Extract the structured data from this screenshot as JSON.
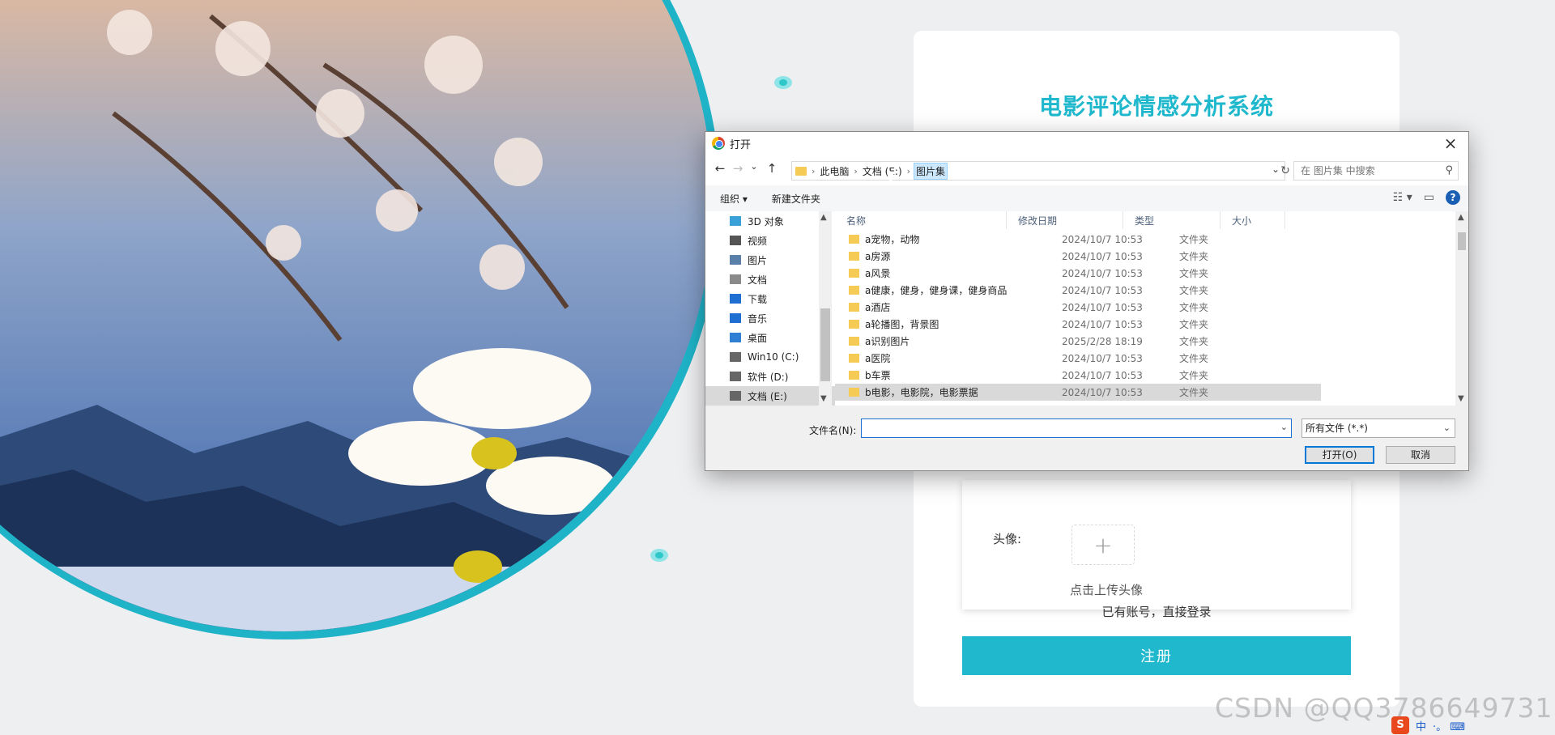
{
  "background": {
    "title": "电影评论情感分析系统",
    "avatar_label": "头像:",
    "avatar_plus": "+",
    "avatar_hint": "点击上传头像",
    "login_link": "已有账号，直接登录",
    "register_button": "注册",
    "accent_color": "#1fb8cd",
    "watermark": "CSDN @QQ3786649731"
  },
  "dialog": {
    "title": "打开",
    "close_icon": "×",
    "nav": {
      "back": "←",
      "forward": "→",
      "recent": "⌄",
      "up": "↑",
      "refresh": "↻"
    },
    "breadcrumbs": [
      "此电脑",
      "文档 (E:)",
      "图片集"
    ],
    "search_placeholder": "在 图片集 中搜索",
    "toolbar": {
      "organize": "组织 ▾",
      "new_folder": "新建文件夹",
      "help": "?"
    },
    "nav_items": [
      {
        "label": "3D 对象",
        "icon": "3d-objects-icon"
      },
      {
        "label": "视频",
        "icon": "video-icon"
      },
      {
        "label": "图片",
        "icon": "pictures-icon"
      },
      {
        "label": "文档",
        "icon": "documents-icon"
      },
      {
        "label": "下载",
        "icon": "download-icon"
      },
      {
        "label": "音乐",
        "icon": "music-icon"
      },
      {
        "label": "桌面",
        "icon": "desktop-icon"
      },
      {
        "label": "Win10 (C:)",
        "icon": "drive-icon"
      },
      {
        "label": "软件 (D:)",
        "icon": "drive-icon"
      },
      {
        "label": "文档 (E:)",
        "icon": "drive-icon",
        "selected": true
      }
    ],
    "columns": [
      "名称",
      "修改日期",
      "类型",
      "大小"
    ],
    "files": [
      {
        "name": "a宠物，动物",
        "date": "2024/10/7 10:53",
        "type": "文件夹"
      },
      {
        "name": "a房源",
        "date": "2024/10/7 10:53",
        "type": "文件夹"
      },
      {
        "name": "a风景",
        "date": "2024/10/7 10:53",
        "type": "文件夹"
      },
      {
        "name": "a健康，健身，健身课，健身商品",
        "date": "2024/10/7 10:53",
        "type": "文件夹"
      },
      {
        "name": "a酒店",
        "date": "2024/10/7 10:53",
        "type": "文件夹"
      },
      {
        "name": "a轮播图，背景图",
        "date": "2024/10/7 10:53",
        "type": "文件夹"
      },
      {
        "name": "a识别图片",
        "date": "2025/2/28 18:19",
        "type": "文件夹"
      },
      {
        "name": "a医院",
        "date": "2024/10/7 10:53",
        "type": "文件夹"
      },
      {
        "name": "b车票",
        "date": "2024/10/7 10:53",
        "type": "文件夹"
      },
      {
        "name": "b电影，电影院，电影票据",
        "date": "2024/10/7 10:53",
        "type": "文件夹",
        "selected": true
      }
    ],
    "filename_label": "文件名(N):",
    "filename_value": "",
    "filter_value": "所有文件 (*.*)",
    "open_button": "打开(O)",
    "cancel_button": "取消"
  },
  "tray": {
    "ime": "中",
    "items": "·。 ⌨"
  }
}
